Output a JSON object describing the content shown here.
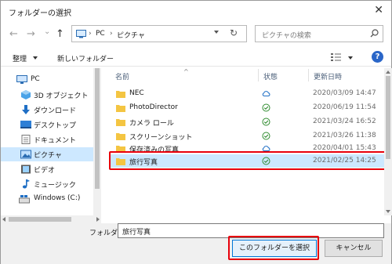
{
  "window": {
    "title": "フォルダーの選択"
  },
  "nav": {
    "back": "←",
    "forward": "→",
    "recent": "⌄",
    "up": "↑",
    "path": [
      "PC",
      "ピクチャ"
    ],
    "path_sep": "›",
    "refresh": "↻",
    "search_placeholder": "ピクチャの検索"
  },
  "toolbar": {
    "organize": "整理",
    "new_folder": "新しいフォルダー"
  },
  "sidebar": {
    "items": [
      {
        "label": "PC",
        "icon": "pc-icon"
      },
      {
        "label": "3D オブジェクト",
        "icon": "3d-objects-icon"
      },
      {
        "label": "ダウンロード",
        "icon": "download-icon"
      },
      {
        "label": "デスクトップ",
        "icon": "desktop-icon"
      },
      {
        "label": "ドキュメント",
        "icon": "documents-icon"
      },
      {
        "label": "ピクチャ",
        "icon": "pictures-icon",
        "selected": true
      },
      {
        "label": "ビデオ",
        "icon": "video-icon"
      },
      {
        "label": "ミュージック",
        "icon": "music-icon"
      },
      {
        "label": "Windows (C:)",
        "icon": "drive-icon"
      }
    ]
  },
  "columns": {
    "name": "名前",
    "status": "状態",
    "date": "更新日時"
  },
  "files": [
    {
      "name": "NEC",
      "status": "cloud",
      "date": "2020/03/09 14:47"
    },
    {
      "name": "PhotoDirector",
      "status": "synced",
      "date": "2020/06/19 11:54"
    },
    {
      "name": "カメラ ロール",
      "status": "synced",
      "date": "2021/03/24 16:52"
    },
    {
      "name": "スクリーンショット",
      "status": "synced",
      "date": "2021/03/26 11:38"
    },
    {
      "name": "保存済みの写真",
      "status": "cloud",
      "date": "2020/04/01 15:43"
    },
    {
      "name": "旅行写真",
      "status": "synced",
      "date": "2021/02/25 14:25",
      "selected": true
    }
  ],
  "footer": {
    "folder_label": "フォルダー:",
    "folder_value": "旅行写真",
    "select_button": "このフォルダーを選択",
    "cancel_button": "キャンセル"
  },
  "colors": {
    "accent": "#0078d7",
    "highlight_red": "#e8000b",
    "folder_yellow": "#f4c542",
    "sync_green": "#2e8b2e",
    "cloud_blue": "#1f6fc5"
  }
}
